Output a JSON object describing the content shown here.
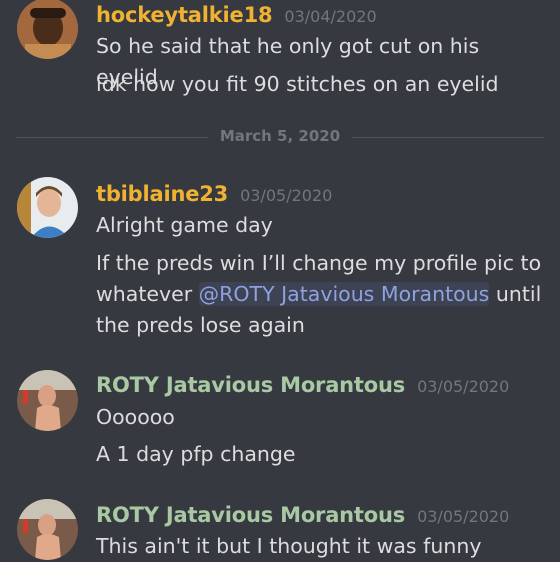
{
  "colors": {
    "background": "#36393f",
    "username_orange": "#f0b232",
    "username_green": "#a9c9a4",
    "timestamp": "#72767d",
    "message_text": "#dcddde",
    "mention": "#8ea1e1"
  },
  "messages": [
    {
      "username": "hockeytalkie18",
      "timestamp": "03/04/2020",
      "avatar": "user-avatar",
      "lines": [
        "So he said that he only got cut on his eyelid",
        "idk how you fit 90 stitches on an eyelid"
      ]
    },
    {
      "username": "tbiblaine23",
      "timestamp": "03/05/2020",
      "avatar": "user-avatar",
      "line1": "Alright game day",
      "line2_before": "If the preds win I’ll change my profile pic to whatever ",
      "line2_mention": "@ROTY Jatavious Morantous",
      "line2_after": " until the preds lose again"
    },
    {
      "username": "ROTY Jatavious Morantous",
      "timestamp": "03/05/2020",
      "avatar": "user-avatar",
      "lines": [
        "Oooooo",
        "A 1 day pfp change"
      ]
    },
    {
      "username": "ROTY Jatavious Morantous",
      "timestamp": "03/05/2020",
      "avatar": "user-avatar",
      "lines": [
        "This ain't it but I thought it was funny"
      ]
    }
  ],
  "date_divider": "March 5, 2020"
}
